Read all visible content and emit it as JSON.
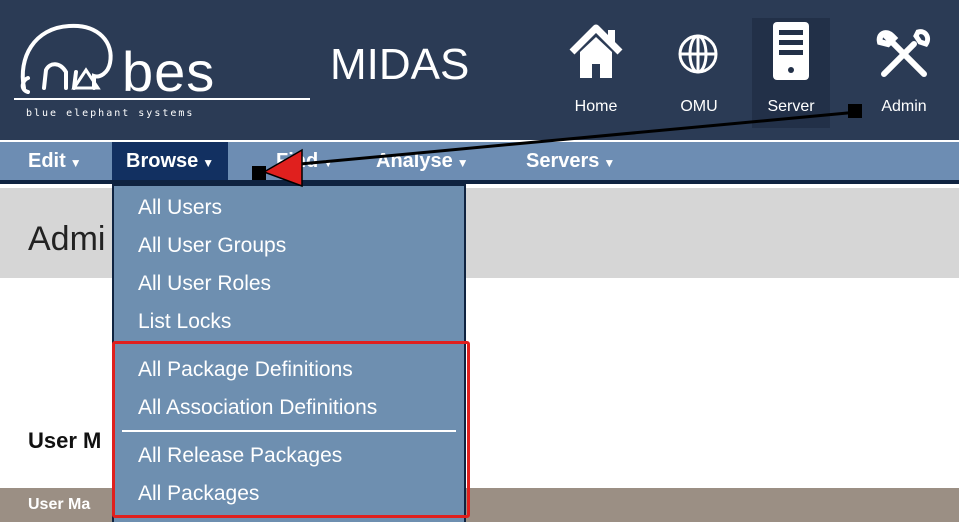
{
  "brand": {
    "logo_word": "bes",
    "logo_tagline": "blue elephant systems",
    "app_title": "MIDAS"
  },
  "top_nav": [
    {
      "label": "Home",
      "icon": "home-icon"
    },
    {
      "label": "OMU",
      "icon": "globe-icon"
    },
    {
      "label": "Server",
      "icon": "server-icon"
    },
    {
      "label": "Admin",
      "icon": "tools-icon"
    }
  ],
  "menubar": {
    "edit": "Edit",
    "browse": "Browse",
    "find": "Find",
    "analyse": "Analyse",
    "servers": "Servers"
  },
  "page": {
    "title": "Admi",
    "section_label": "User M",
    "table_header": "User Ma"
  },
  "browse_menu": {
    "group1": [
      "All Users",
      "All User Groups",
      "All User Roles",
      "List Locks"
    ],
    "group2": [
      "All Package Definitions",
      "All Association Definitions"
    ],
    "group3": [
      "All Release Packages",
      "All Packages"
    ]
  },
  "colors": {
    "header_bg": "#2b3b55",
    "menubar_bg": "#6d8db3",
    "active_menu_bg": "#123061",
    "dropdown_bg": "#6e8fb0",
    "annotation_red": "#e0201e"
  }
}
